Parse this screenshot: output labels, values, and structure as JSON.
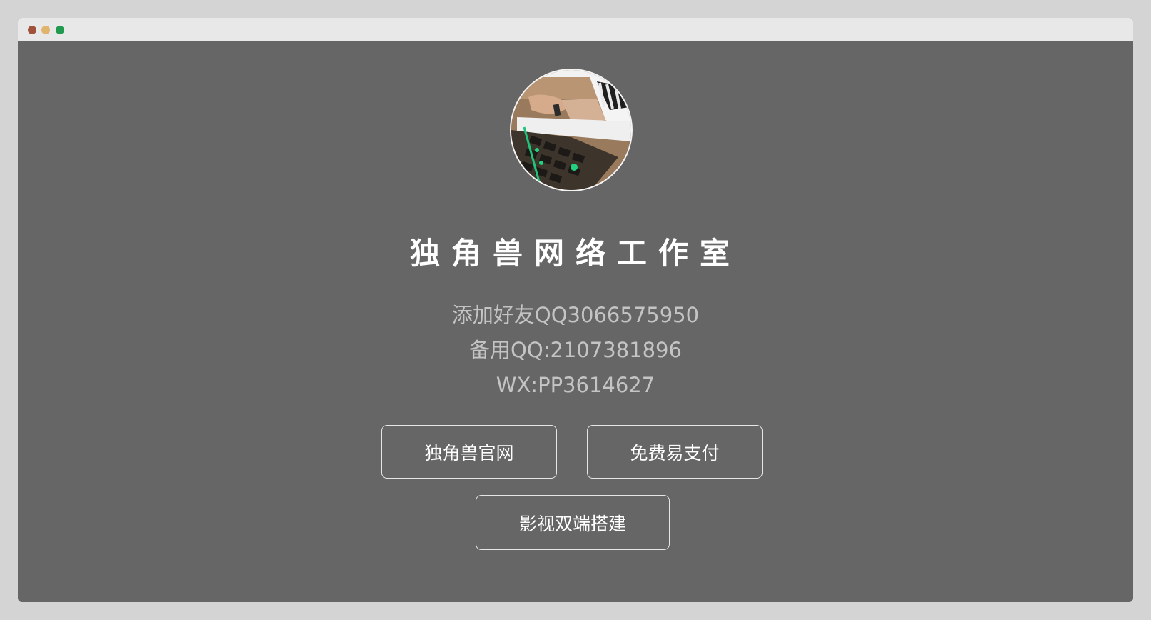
{
  "window": {
    "controls": [
      "close",
      "minimize",
      "maximize"
    ],
    "colors": {
      "close": "#a0523a",
      "minimize": "#e0b46a",
      "maximize": "#1f9a4f"
    }
  },
  "profile": {
    "avatar_icon": "keyboard-photo",
    "title": "独角兽网络工作室",
    "contact": {
      "qq_line": "添加好友QQ3066575950",
      "backup_qq_line": "备用QQ:2107381896",
      "wx_line": "WX:PP3614627"
    }
  },
  "buttons": {
    "official_site": "独角兽官网",
    "free_epay": "免费易支付",
    "video_build": "影视双端搭建"
  },
  "colors": {
    "background": "#666666",
    "titlebar": "#e8e8e8",
    "text": "#ffffff",
    "muted_text": "#c4c4c4"
  }
}
